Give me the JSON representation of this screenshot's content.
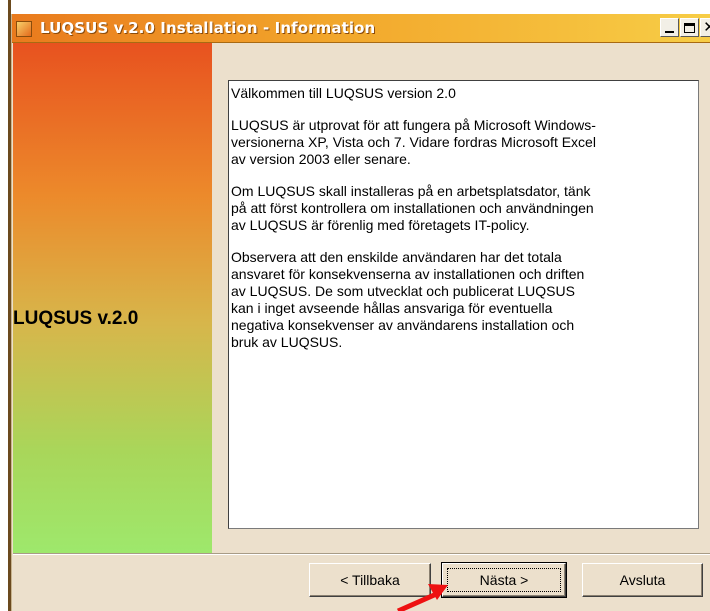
{
  "window": {
    "title": "LUQSUS v.2.0 Installation - Information",
    "controls": {
      "minimize": "minimize",
      "maximize": "maximize",
      "close": "close"
    }
  },
  "sidebar": {
    "label": "LUQSUS v.2.0"
  },
  "info": {
    "paragraphs": [
      "Välkommen till LUQSUS version 2.0",
      "LUQSUS är utprovat för att fungera på Microsoft Windows-\nversionerna XP, Vista och 7. Vidare fordras Microsoft Excel\nav version 2003 eller senare.",
      "Om LUQSUS skall installeras på en arbetsplatsdator, tänk\npå att först kontrollera om installationen och användningen\nav LUQSUS är förenlig med företagets IT-policy.",
      "Observera att den enskilde användaren har det totala\nansvaret för konsekvenserna av installationen och driften\nav LUQSUS. De som utvecklat och publicerat LUQSUS\nkan i inget avseende hållas ansvariga för eventuella\nnegativa konsekvenser av användarens installation och\nbruk av LUQSUS."
    ]
  },
  "buttons": {
    "back": "< Tillbaka",
    "next": "Nästa >",
    "exit": "Avsluta"
  },
  "colors": {
    "titlebar_start": "#e97a1d",
    "titlebar_end": "#f7cd46",
    "arrow": "#ee1111",
    "dialog_bg": "#ece0cc"
  },
  "icons": {
    "app": "installer-icon",
    "arrow": "red-pointer-arrow"
  }
}
